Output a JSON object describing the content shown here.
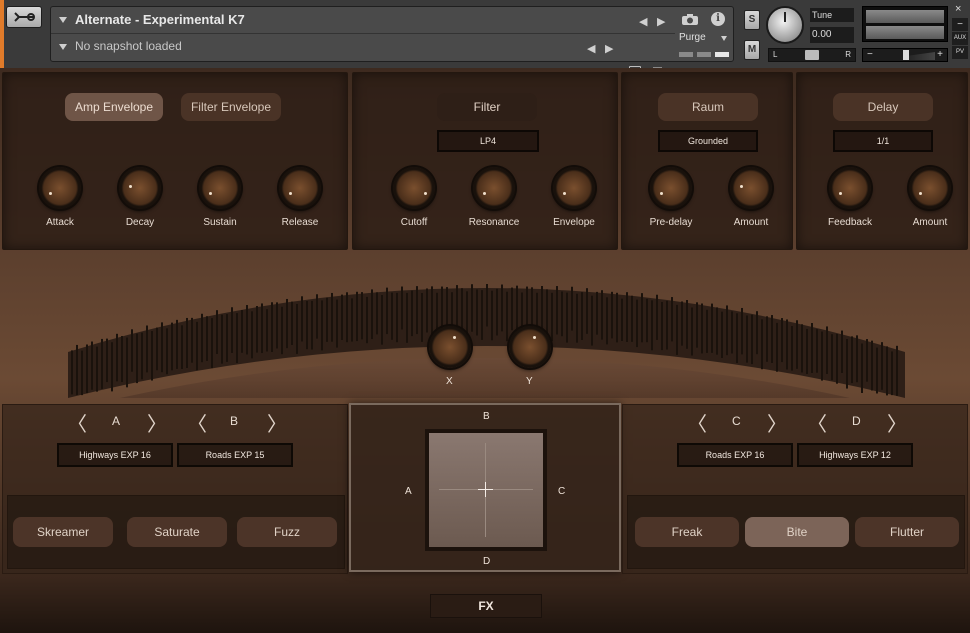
{
  "header": {
    "instrument_title": "Alternate - Experimental K7",
    "snapshot": "No snapshot loaded",
    "purge_label": "Purge",
    "solo_label": "S",
    "mute_label": "M",
    "tune_label": "Tune",
    "tune_value": "0.00",
    "pan_left": "L",
    "pan_right": "R",
    "vol_minus": "−",
    "vol_plus": "+",
    "aux_label": "AUX",
    "pv_label": "PV",
    "close_glyph": "×",
    "minus_glyph": "−",
    "prev_glyph": "◀",
    "next_glyph": "▶",
    "info_glyph": "i"
  },
  "envelope": {
    "tabs": [
      "Amp Envelope",
      "Filter Envelope"
    ],
    "active_tab": "Amp Envelope",
    "knobs": [
      "Attack",
      "Decay",
      "Sustain",
      "Release"
    ]
  },
  "filter": {
    "title": "Filter",
    "type": "LP4",
    "knobs": [
      "Cutoff",
      "Resonance",
      "Envelope"
    ]
  },
  "raum": {
    "title": "Raum",
    "mode": "Grounded",
    "knobs": [
      "Pre-delay",
      "Amount"
    ]
  },
  "delay": {
    "title": "Delay",
    "time": "1/1",
    "knobs": [
      "Feedback",
      "Amount"
    ]
  },
  "xy_knobs": {
    "x_label": "X",
    "y_label": "Y"
  },
  "left_slots": {
    "slot_a": "A",
    "slot_b": "B",
    "preset_a": "Highways EXP 16",
    "preset_b": "Roads EXP 15",
    "modules": [
      "Skreamer",
      "Saturate",
      "Fuzz"
    ]
  },
  "right_slots": {
    "slot_c": "C",
    "slot_d": "D",
    "preset_c": "Roads EXP 16",
    "preset_d": "Highways EXP 12",
    "modules": [
      "Freak",
      "Bite",
      "Flutter"
    ],
    "active_module": "Bite"
  },
  "xy_pad": {
    "top": "B",
    "left": "A",
    "right": "C",
    "bottom": "D"
  },
  "fx_button": "FX",
  "chevrons": {
    "left": "〈",
    "right": "〉"
  }
}
